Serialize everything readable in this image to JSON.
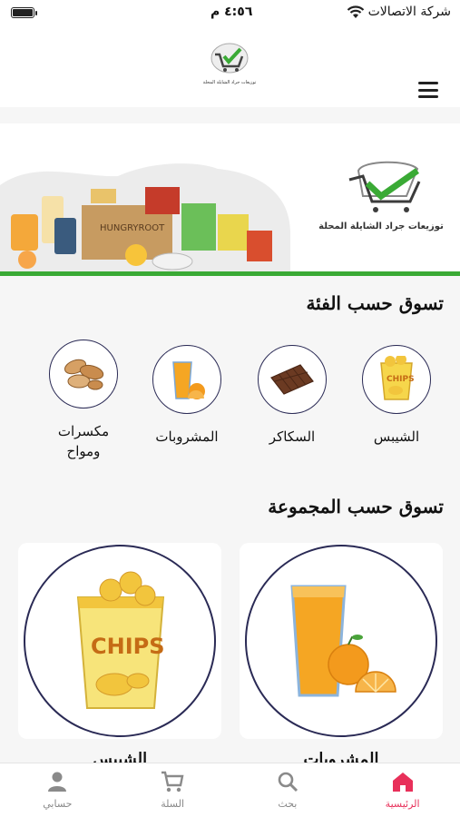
{
  "status": {
    "time": "٤:٥٦ م",
    "carrier": "شركة الاتصالات"
  },
  "header": {
    "logo_text": "توزيعات جراد الشايلة المحلة"
  },
  "banner": {
    "logo_text": "توزيعات جراد الشايلة المحلة",
    "accent": "#3aaa35"
  },
  "categories": {
    "title": "تسوق حسب الفئة",
    "items": [
      {
        "label": "الشيبس",
        "icon": "chips-icon"
      },
      {
        "label": "السكاكر",
        "icon": "chocolate-icon"
      },
      {
        "label": "المشروبات",
        "icon": "juice-icon"
      },
      {
        "label": "مكسرات ومواح",
        "icon": "nuts-icon"
      }
    ]
  },
  "groups": {
    "title": "تسوق حسب المجموعة",
    "items": [
      {
        "label": "المشروبات",
        "icon": "juice-icon"
      },
      {
        "label": "الشيبس",
        "icon": "chips-icon"
      }
    ]
  },
  "tabbar": {
    "items": [
      {
        "label": "الرئيسية",
        "icon": "home-icon",
        "active": true
      },
      {
        "label": "بحث",
        "icon": "search-icon"
      },
      {
        "label": "السلة",
        "icon": "cart-icon"
      },
      {
        "label": "حسابي",
        "icon": "user-icon"
      }
    ],
    "active_color": "#e8305a"
  }
}
